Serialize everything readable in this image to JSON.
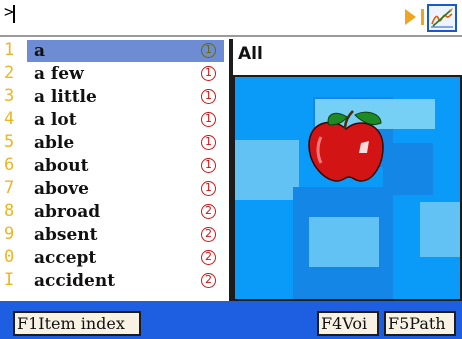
{
  "input": {
    "prompt_symbol": ">",
    "value": ""
  },
  "toolbar": {
    "play_icon": "play-icon",
    "sign_icon": "handwriting-icon"
  },
  "wordlist": {
    "items": [
      {
        "number": "1",
        "word": "a",
        "level": "1",
        "selected": true
      },
      {
        "number": "2",
        "word": "a few",
        "level": "1"
      },
      {
        "number": "3",
        "word": "a little",
        "level": "1"
      },
      {
        "number": "4",
        "word": "a lot",
        "level": "1"
      },
      {
        "number": "5",
        "word": "able",
        "level": "1"
      },
      {
        "number": "6",
        "word": "about",
        "level": "1"
      },
      {
        "number": "7",
        "word": "above",
        "level": "1"
      },
      {
        "number": "8",
        "word": "abroad",
        "level": "2"
      },
      {
        "number": "9",
        "word": "absent",
        "level": "2"
      },
      {
        "number": "0",
        "word": "accept",
        "level": "2"
      },
      {
        "number": "I",
        "word": "accident",
        "level": "2"
      }
    ]
  },
  "panel": {
    "title": "All",
    "image": "apple-icon"
  },
  "bottom": {
    "f1": "F1Item index",
    "f4": "F4Voi",
    "f5": "F5Path"
  },
  "colors": {
    "selected": "#6e8cd4",
    "number": "#f0b41e",
    "level_border": "#d51212",
    "bottom_bar": "#1d5fe0",
    "picture_bg": "#0ea0ff"
  }
}
